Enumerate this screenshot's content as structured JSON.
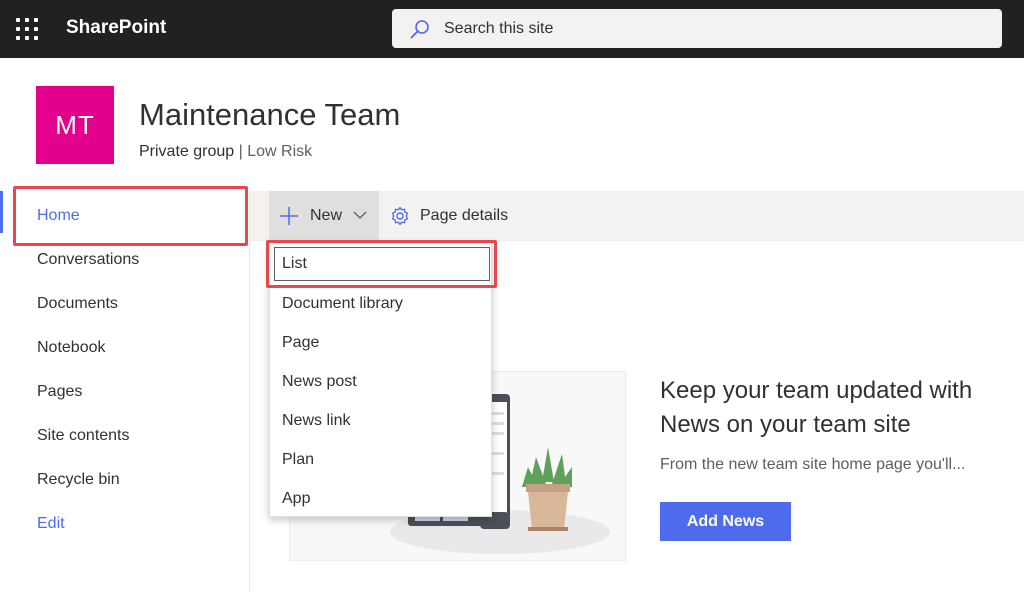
{
  "suite": {
    "brand": "SharePoint",
    "search_placeholder": "Search this site"
  },
  "site": {
    "logo_initials": "MT",
    "logo_color": "#e3008c",
    "title": "Maintenance Team",
    "privacy": "Private group",
    "separator": "|",
    "classification": "Low Risk"
  },
  "nav": {
    "items": [
      "Home",
      "Conversations",
      "Documents",
      "Notebook",
      "Pages",
      "Site contents",
      "Recycle bin"
    ],
    "edit_label": "Edit",
    "active_color": "#4f6bed"
  },
  "commandbar": {
    "new_label": "New",
    "page_details_label": "Page details"
  },
  "new_menu": {
    "items": [
      "List",
      "Document library",
      "Page",
      "News post",
      "News link",
      "Plan",
      "App"
    ]
  },
  "news": {
    "heading_line1": "Keep your team updated with",
    "heading_line2": "News on your team site",
    "description": "From the new team site home page you'll...",
    "button_label": "Add News",
    "accent": "#4f6bed"
  },
  "annotation_color": "#e8474c"
}
